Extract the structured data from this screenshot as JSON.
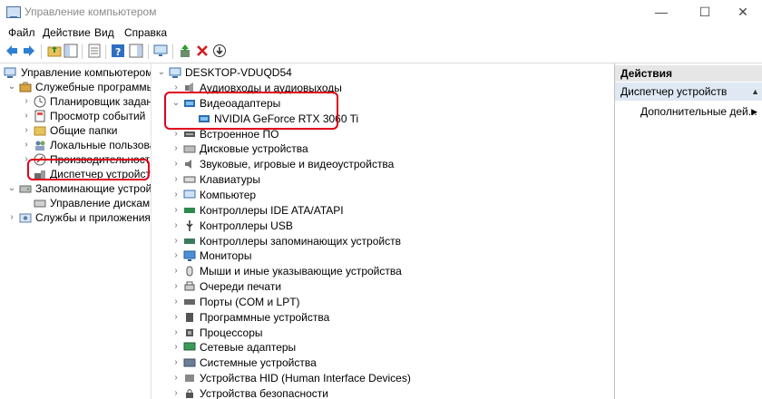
{
  "window": {
    "title": "Управление компьютером",
    "buttons": {
      "minimize": "—",
      "maximize": "☐",
      "close": "✕"
    }
  },
  "menu": [
    "Файл",
    "Действие",
    "Вид",
    "Справка"
  ],
  "left_tree": [
    {
      "label": "Управление компьютером (л",
      "chevron": "",
      "level": 0
    },
    {
      "label": "Служебные программы",
      "chevron": "⌄",
      "level": 1
    },
    {
      "label": "Планировщик заданий",
      "chevron": "›",
      "level": 2
    },
    {
      "label": "Просмотр событий",
      "chevron": "›",
      "level": 2
    },
    {
      "label": "Общие папки",
      "chevron": "›",
      "level": 2
    },
    {
      "label": "Локальные пользовате",
      "chevron": "›",
      "level": 2
    },
    {
      "label": "Производительность",
      "chevron": "›",
      "level": 2
    },
    {
      "label": "Диспетчер устройств",
      "chevron": "",
      "level": 2
    },
    {
      "label": "Запоминающие устройст",
      "chevron": "⌄",
      "level": 1
    },
    {
      "label": "Управление дисками",
      "chevron": "",
      "level": 2
    },
    {
      "label": "Службы и приложения",
      "chevron": "›",
      "level": 1
    }
  ],
  "device_tree": {
    "root": "DESKTOP-VDUQD54",
    "items": [
      {
        "label": "Аудиовходы и аудиовыходы",
        "chevron": "›"
      },
      {
        "label": "Видеоадаптеры",
        "chevron": "⌄"
      },
      {
        "label": "NVIDIA GeForce RTX 3060 Ti",
        "chevron": "",
        "child": true
      },
      {
        "label": "Встроенное ПО",
        "chevron": "›"
      },
      {
        "label": "Дисковые устройства",
        "chevron": "›"
      },
      {
        "label": "Звуковые, игровые и видеоустройства",
        "chevron": "›"
      },
      {
        "label": "Клавиатуры",
        "chevron": "›"
      },
      {
        "label": "Компьютер",
        "chevron": "›"
      },
      {
        "label": "Контроллеры IDE ATA/ATAPI",
        "chevron": "›"
      },
      {
        "label": "Контроллеры USB",
        "chevron": "›"
      },
      {
        "label": "Контроллеры запоминающих устройств",
        "chevron": "›"
      },
      {
        "label": "Мониторы",
        "chevron": "›"
      },
      {
        "label": "Мыши и иные указывающие устройства",
        "chevron": "›"
      },
      {
        "label": "Очереди печати",
        "chevron": "›"
      },
      {
        "label": "Порты (COM и LPT)",
        "chevron": "›"
      },
      {
        "label": "Программные устройства",
        "chevron": "›"
      },
      {
        "label": "Процессоры",
        "chevron": "›"
      },
      {
        "label": "Сетевые адаптеры",
        "chevron": "›"
      },
      {
        "label": "Системные устройства",
        "chevron": "›"
      },
      {
        "label": "Устройства HID (Human Interface Devices)",
        "chevron": "›"
      },
      {
        "label": "Устройства безопасности",
        "chevron": "›"
      }
    ]
  },
  "actions": {
    "header": "Действия",
    "selected": "Диспетчер устройств",
    "more": "Дополнительные дей..."
  },
  "colors": {
    "highlight": "#e0001b",
    "selection": "#dfe8f3"
  }
}
